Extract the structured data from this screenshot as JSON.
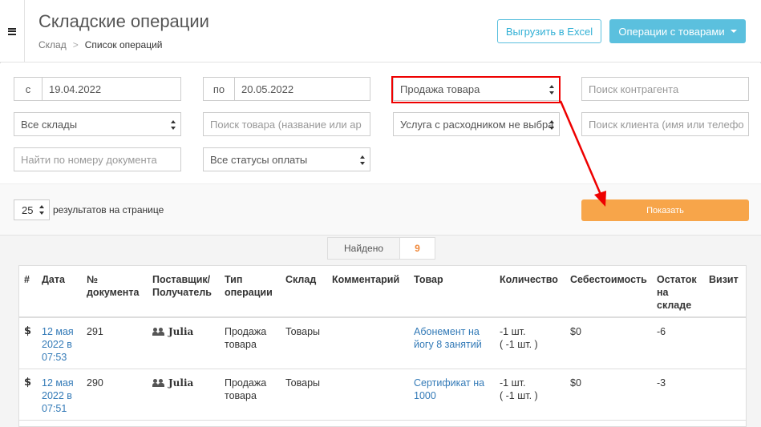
{
  "header": {
    "title": "Складские операции",
    "breadcrumb": {
      "parent": "Склад",
      "separator": ">",
      "current": "Список операций"
    },
    "export_button": "Выгрузить в Excel",
    "operations_button": "Операции с товарами"
  },
  "filters": {
    "date_from_label": "с",
    "date_from": "19.04.2022",
    "date_to_label": "по",
    "date_to": "20.05.2022",
    "operation_type": "Продажа товара",
    "counterparty_placeholder": "Поиск контрагента",
    "warehouse": "Все склады",
    "product_placeholder": "Поиск товара (название или ар",
    "service": "Услуга с расходником не выбра",
    "client_placeholder": "Поиск клиента (имя или телефо",
    "document_placeholder": "Найти по номеру документа",
    "payment_status": "Все статусы оплаты"
  },
  "pagination": {
    "per_page": "25",
    "per_page_label": "результатов на странице",
    "show_button": "Показать"
  },
  "results": {
    "found_label": "Найдено",
    "found_count": "9"
  },
  "table": {
    "headers": [
      "#",
      "Дата",
      "№ документа",
      "Поставщик/ Получатель",
      "Тип операции",
      "Склад",
      "Комментарий",
      "Товар",
      "Количество",
      "Себестоимость",
      "Остаток на складе",
      "Визит"
    ],
    "rows": [
      {
        "icon": "$",
        "date": "12 мая 2022 в 07:53",
        "doc": "291",
        "party": "Julia",
        "type": "Продажа товара",
        "warehouse": "Товары",
        "comment": "",
        "product": "Абонемент на йогу 8 занятий",
        "qty": "-1 шт.",
        "qty_sub": "( -1 шт. )",
        "cost": "$0",
        "stock": "-6",
        "visit": ""
      },
      {
        "icon": "$",
        "date": "12 мая 2022 в 07:51",
        "doc": "290",
        "party": "Julia",
        "type": "Продажа товара",
        "warehouse": "Товары",
        "comment": "",
        "product": "Сертификат на 1000",
        "qty": "-1 шт.",
        "qty_sub": "( -1 шт. )",
        "cost": "$0",
        "stock": "-3",
        "visit": ""
      }
    ]
  },
  "colors": {
    "info": "#5bc0de",
    "orange": "#f7a54a",
    "link": "#337ab7",
    "annotation": "#e00000"
  }
}
